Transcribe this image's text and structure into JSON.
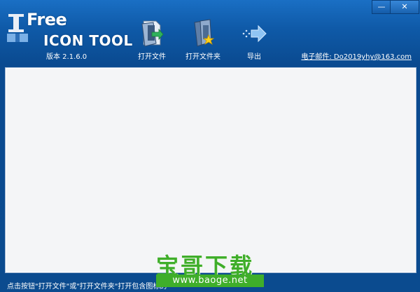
{
  "app": {
    "logo_word_free": "Free",
    "logo_word_tool": "ICON TOOL",
    "version": "版本 2.1.6.0"
  },
  "toolbar": {
    "open_file": "打开文件",
    "open_folder": "打开文件夹",
    "export": "导出"
  },
  "email": "电子邮件: Do2019yhy@163.com",
  "window_controls": {
    "minimize": "—",
    "close": "✕"
  },
  "status_text": "点击按钮\"打开文件\"或\"打开文件夹\"打开包含图标的",
  "watermark": {
    "brand": "宝哥下载",
    "url": "www.baoge.net"
  },
  "colors": {
    "title_bg": "#0f5aa8",
    "content_bg": "#f4f5f7",
    "watermark": "#3fae2a"
  },
  "icons": [
    "logo-mark-icon",
    "open-file-icon",
    "open-folder-icon",
    "export-icon"
  ]
}
